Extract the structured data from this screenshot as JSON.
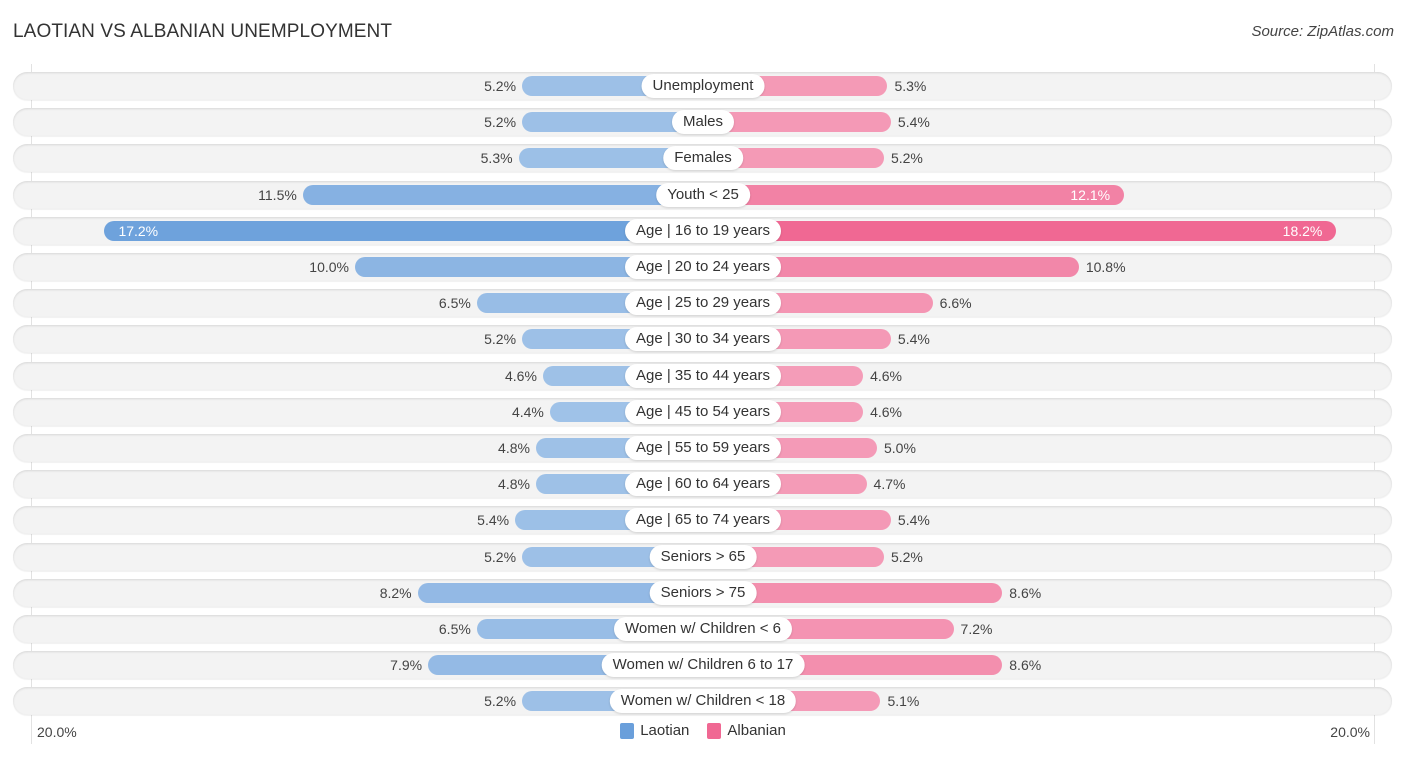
{
  "header": {
    "title": "LAOTIAN VS ALBANIAN UNEMPLOYMENT",
    "source": "Source: ZipAtlas.com"
  },
  "colors": {
    "laotian": "#6a9fdb",
    "albanian": "#f06893",
    "laotian_light": "#a9c8ea",
    "albanian_light": "#f5a6bf"
  },
  "chart_data": {
    "type": "bar",
    "orientation": "horizontal-diverging",
    "title": "LAOTIAN VS ALBANIAN UNEMPLOYMENT",
    "xlim": [
      -20.0,
      20.0
    ],
    "axis_labels": {
      "left": "20.0%",
      "right": "20.0%"
    },
    "legend": {
      "position": "bottom-center",
      "entries": [
        "Laotian",
        "Albanian"
      ]
    },
    "categories": [
      "Unemployment",
      "Males",
      "Females",
      "Youth < 25",
      "Age | 16 to 19 years",
      "Age | 20 to 24 years",
      "Age | 25 to 29 years",
      "Age | 30 to 34 years",
      "Age | 35 to 44 years",
      "Age | 45 to 54 years",
      "Age | 55 to 59 years",
      "Age | 60 to 64 years",
      "Age | 65 to 74 years",
      "Seniors > 65",
      "Seniors > 75",
      "Women w/ Children < 6",
      "Women w/ Children 6 to 17",
      "Women w/ Children < 18"
    ],
    "series": [
      {
        "name": "Laotian",
        "side": "left",
        "values": [
          5.2,
          5.2,
          5.3,
          11.5,
          17.2,
          10.0,
          6.5,
          5.2,
          4.6,
          4.4,
          4.8,
          4.8,
          5.4,
          5.2,
          8.2,
          6.5,
          7.9,
          5.2
        ],
        "labels": [
          "5.2%",
          "5.2%",
          "5.3%",
          "11.5%",
          "17.2%",
          "10.0%",
          "6.5%",
          "5.2%",
          "4.6%",
          "4.4%",
          "4.8%",
          "4.8%",
          "5.4%",
          "5.2%",
          "8.2%",
          "6.5%",
          "7.9%",
          "5.2%"
        ]
      },
      {
        "name": "Albanian",
        "side": "right",
        "values": [
          5.3,
          5.4,
          5.2,
          12.1,
          18.2,
          10.8,
          6.6,
          5.4,
          4.6,
          4.6,
          5.0,
          4.7,
          5.4,
          5.2,
          8.6,
          7.2,
          8.6,
          5.1
        ],
        "labels": [
          "5.3%",
          "5.4%",
          "5.2%",
          "12.1%",
          "18.2%",
          "10.8%",
          "6.6%",
          "5.4%",
          "4.6%",
          "4.6%",
          "5.0%",
          "4.7%",
          "5.4%",
          "5.2%",
          "8.6%",
          "7.2%",
          "8.6%",
          "5.1%"
        ]
      }
    ]
  }
}
